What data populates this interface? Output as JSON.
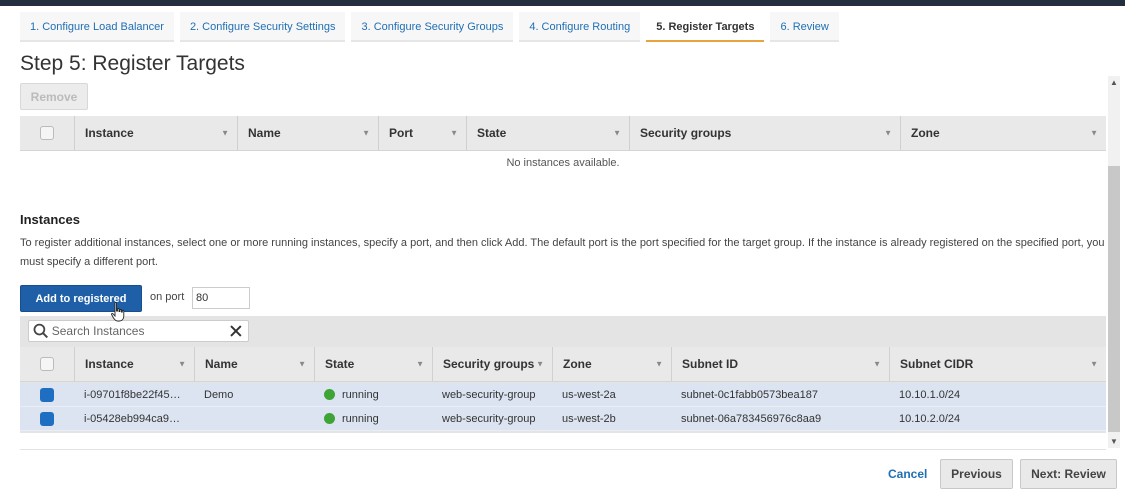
{
  "tabs": [
    {
      "label": "1. Configure Load Balancer"
    },
    {
      "label": "2. Configure Security Settings"
    },
    {
      "label": "3. Configure Security Groups"
    },
    {
      "label": "4. Configure Routing"
    },
    {
      "label": "5. Register Targets",
      "active": true
    },
    {
      "label": "6. Review"
    }
  ],
  "page_title": "Step 5: Register Targets",
  "remove_label": "Remove",
  "registered_table": {
    "columns": [
      "Instance",
      "Name",
      "Port",
      "State",
      "Security groups",
      "Zone"
    ],
    "empty_message": "No instances available."
  },
  "instances_section": {
    "title": "Instances",
    "description": "To register additional instances, select one or more running instances, specify a port, and then click Add. The default port is the port specified for the target group. If the instance is already registered on the specified port, you must specify a different port."
  },
  "add_button_label": "Add to registered",
  "port_label": "on port",
  "port_value": "80",
  "search": {
    "placeholder": "Search Instances",
    "value": ""
  },
  "instances_table": {
    "columns": [
      "Instance",
      "Name",
      "State",
      "Security groups",
      "Zone",
      "Subnet ID",
      "Subnet CIDR"
    ],
    "rows": [
      {
        "checked": true,
        "instance": "i-09701f8be22f45…",
        "name": "Demo",
        "state": "running",
        "security_groups": "web-security-group",
        "zone": "us-west-2a",
        "subnet_id": "subnet-0c1fabb0573bea187",
        "subnet_cidr": "10.10.1.0/24"
      },
      {
        "checked": true,
        "instance": "i-05428eb994ca9…",
        "name": "",
        "state": "running",
        "security_groups": "web-security-group",
        "zone": "us-west-2b",
        "subnet_id": "subnet-06a783456976c8aa9",
        "subnet_cidr": "10.10.2.0/24"
      }
    ]
  },
  "footer": {
    "cancel": "Cancel",
    "previous": "Previous",
    "next": "Next: Review"
  },
  "colors": {
    "primary_button": "#1e5fa8",
    "link": "#1f6fb5",
    "active_tab_underline": "#e8a33c",
    "running_status": "#3ea435",
    "selected_row": "#dbe4f0"
  }
}
